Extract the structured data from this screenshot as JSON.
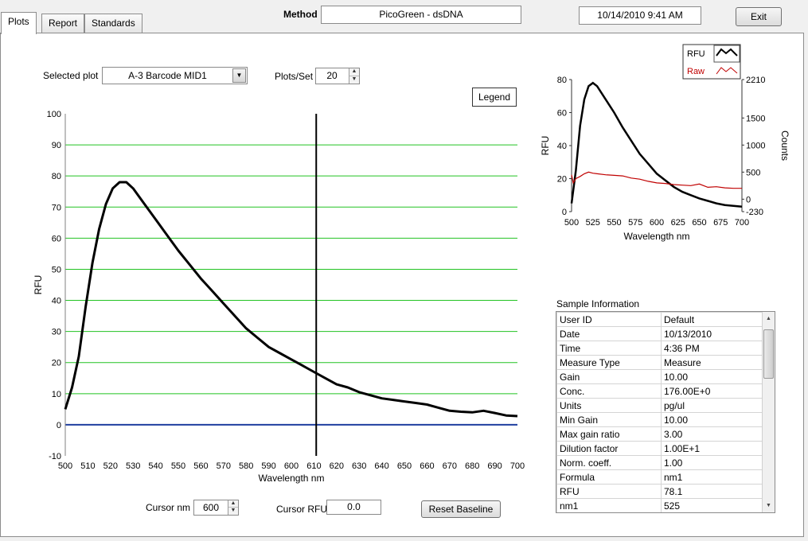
{
  "tabs": [
    {
      "label": "Plots"
    },
    {
      "label": "Report"
    },
    {
      "label": "Standards"
    }
  ],
  "header": {
    "method_label": "Method",
    "method_value": "PicoGreen - dsDNA",
    "datetime": "10/14/2010  9:41 AM",
    "exit_label": "Exit"
  },
  "controls": {
    "selected_plot_label": "Selected plot",
    "selected_plot_value": "A-3 Barcode MID1",
    "plots_per_set_label": "Plots/Set",
    "plots_per_set_value": "20",
    "legend_button_label": "Legend",
    "cursor_nm_label": "Cursor nm",
    "cursor_nm_value": "600",
    "cursor_rfu_label": "Cursor RFU",
    "cursor_rfu_value": "0.0",
    "reset_baseline_label": "Reset Baseline"
  },
  "chart_data": [
    {
      "type": "line",
      "xlabel": "Wavelength nm",
      "ylabel": "RFU",
      "xlim": [
        500,
        700
      ],
      "ylim": [
        -10,
        100
      ],
      "x_ticks": [
        500,
        510,
        520,
        530,
        540,
        550,
        560,
        570,
        580,
        590,
        600,
        610,
        620,
        630,
        640,
        650,
        660,
        670,
        680,
        690,
        700
      ],
      "y_ticks": [
        -10,
        0,
        10,
        20,
        30,
        40,
        50,
        60,
        70,
        80,
        90,
        100
      ],
      "grid": "horizontal",
      "grid_color": "#22c322",
      "baseline_value": 0,
      "baseline_color": "#1f3fa0",
      "cursor_x": 611,
      "series": [
        {
          "color": "#000000",
          "x": [
            500,
            503,
            506,
            509,
            512,
            515,
            518,
            521,
            524,
            527,
            530,
            535,
            540,
            545,
            550,
            555,
            560,
            565,
            570,
            575,
            580,
            585,
            590,
            595,
            600,
            605,
            610,
            615,
            620,
            625,
            630,
            635,
            640,
            645,
            650,
            655,
            660,
            665,
            670,
            675,
            680,
            685,
            690,
            695,
            700
          ],
          "y": [
            5,
            12,
            22,
            38,
            52,
            63,
            71,
            76,
            78,
            78,
            76,
            71,
            66,
            61,
            56,
            51.5,
            47,
            43,
            39,
            35,
            31,
            28,
            25,
            23,
            21,
            19,
            17,
            15,
            13,
            12,
            10.5,
            9.5,
            8.5,
            8,
            7.5,
            7,
            6.5,
            5.5,
            4.5,
            4.2,
            4,
            4.5,
            3.8,
            3,
            2.8
          ]
        }
      ]
    },
    {
      "type": "line",
      "xlabel": "Wavelength  nm",
      "ylabel": "RFU",
      "y2label": "Counts",
      "xlim": [
        500,
        700
      ],
      "ylim": [
        0,
        80
      ],
      "y2lim": [
        -230,
        2210
      ],
      "x_ticks": [
        500,
        525,
        550,
        575,
        600,
        625,
        650,
        675,
        700
      ],
      "y_ticks": [
        0,
        20,
        40,
        60,
        80
      ],
      "y2_ticks": [
        -230,
        0,
        500,
        1000,
        1500,
        2210
      ],
      "legend": "top-right",
      "series": [
        {
          "name": "RFU",
          "color": "#000000",
          "axis": "left",
          "x": [
            500,
            505,
            510,
            515,
            520,
            525,
            530,
            540,
            550,
            560,
            570,
            580,
            590,
            600,
            610,
            620,
            630,
            640,
            650,
            660,
            670,
            680,
            690,
            700
          ],
          "y": [
            5,
            25,
            52,
            68,
            76,
            78,
            76,
            68,
            60,
            51,
            43,
            35,
            29,
            23,
            19,
            15,
            12,
            10,
            8,
            6.5,
            5,
            4,
            3.5,
            3
          ]
        },
        {
          "name": "Raw",
          "color": "#c00000",
          "axis": "right",
          "x": [
            500,
            502,
            505,
            510,
            515,
            520,
            525,
            530,
            540,
            550,
            560,
            570,
            580,
            590,
            600,
            610,
            620,
            630,
            640,
            650,
            660,
            670,
            680,
            690,
            700
          ],
          "y": [
            450,
            300,
            380,
            420,
            470,
            500,
            480,
            470,
            450,
            440,
            430,
            390,
            370,
            330,
            300,
            290,
            270,
            260,
            250,
            280,
            220,
            230,
            210,
            200,
            200
          ]
        }
      ]
    }
  ],
  "sample_info": {
    "title": "Sample Information",
    "rows": [
      [
        "User ID",
        "Default"
      ],
      [
        "Date",
        "10/13/2010"
      ],
      [
        "Time",
        "4:36 PM"
      ],
      [
        "Measure Type",
        "Measure"
      ],
      [
        "Gain",
        "10.00"
      ],
      [
        "Conc.",
        "176.00E+0"
      ],
      [
        "Units",
        "pg/ul"
      ],
      [
        "Min Gain",
        "10.00"
      ],
      [
        "Max gain ratio",
        "3.00"
      ],
      [
        "Dilution factor",
        "1.00E+1"
      ],
      [
        "Norm. coeff.",
        "1.00"
      ],
      [
        "Formula",
        "nm1"
      ],
      [
        "RFU",
        "78.1"
      ],
      [
        "nm1",
        "525"
      ]
    ]
  }
}
